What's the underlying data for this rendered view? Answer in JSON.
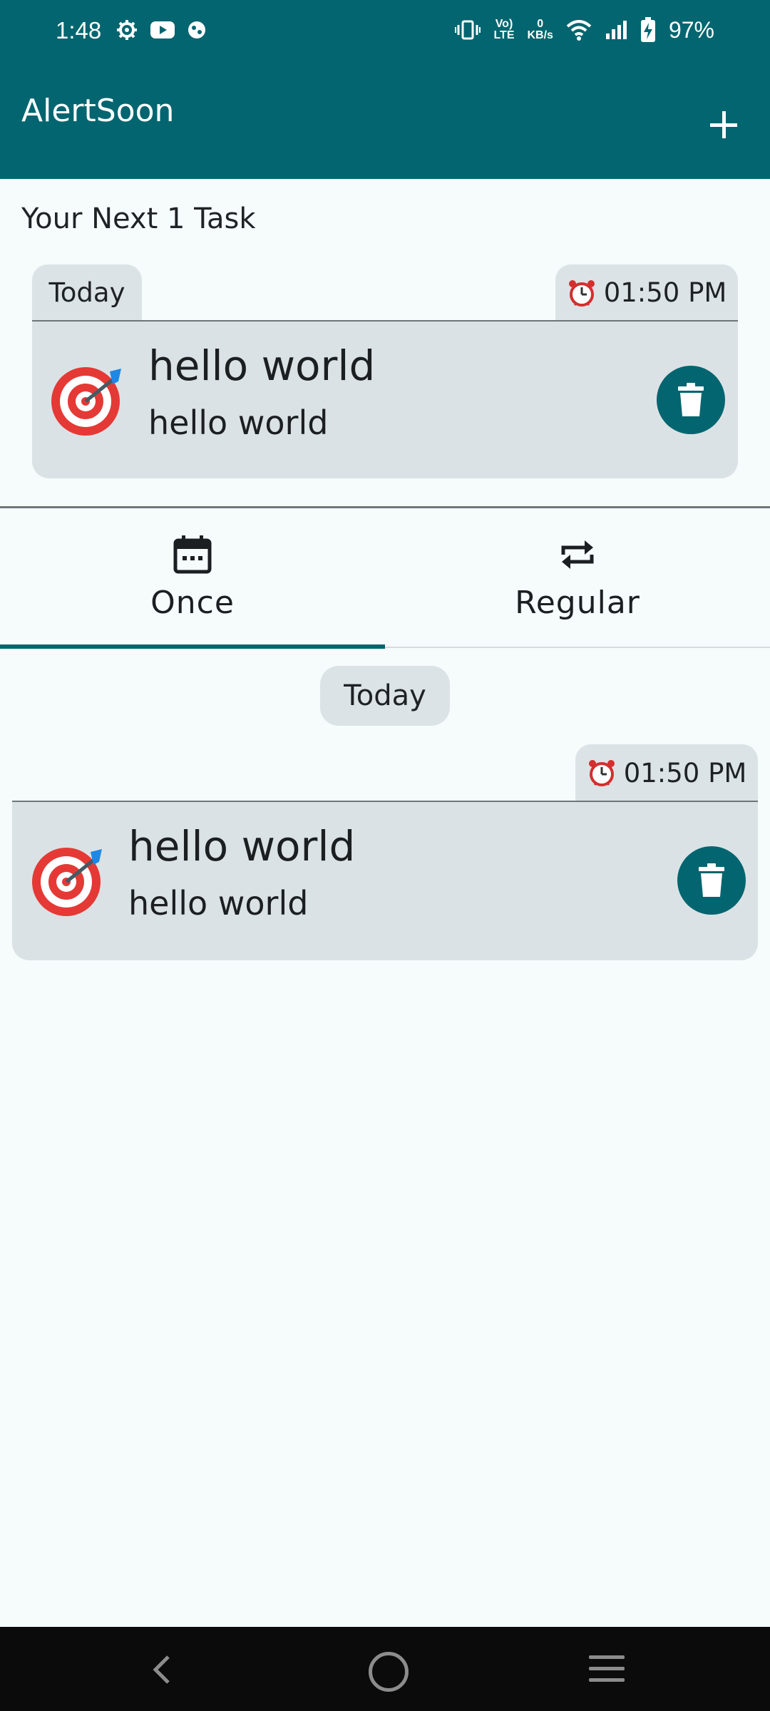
{
  "status_bar": {
    "time": "1:48",
    "battery": "97%",
    "data_rate_value": "0",
    "data_rate_unit": "KB/s",
    "volte_top": "Vo)",
    "volte_bottom": "LTE"
  },
  "app_bar": {
    "title": "AlertSoon",
    "add_icon": "plus-icon"
  },
  "next_tasks": {
    "heading": "Your Next 1 Task",
    "day_chip": "Today",
    "time_chip": "01:50 PM",
    "task": {
      "icon": "dart-target-icon",
      "title": "hello world",
      "subtitle": "hello world"
    }
  },
  "tabs": [
    {
      "label": "Once",
      "icon": "calendar-icon",
      "selected": true
    },
    {
      "label": "Regular",
      "icon": "repeat-icon",
      "selected": false
    }
  ],
  "list": {
    "date_header": "Today",
    "items": [
      {
        "time": "01:50 PM",
        "title": "hello world",
        "subtitle": "hello world",
        "icon": "dart-target-icon"
      }
    ]
  },
  "colors": {
    "primary": "#02656f",
    "card": "#dbe2e5",
    "background": "#f6fbfc"
  }
}
